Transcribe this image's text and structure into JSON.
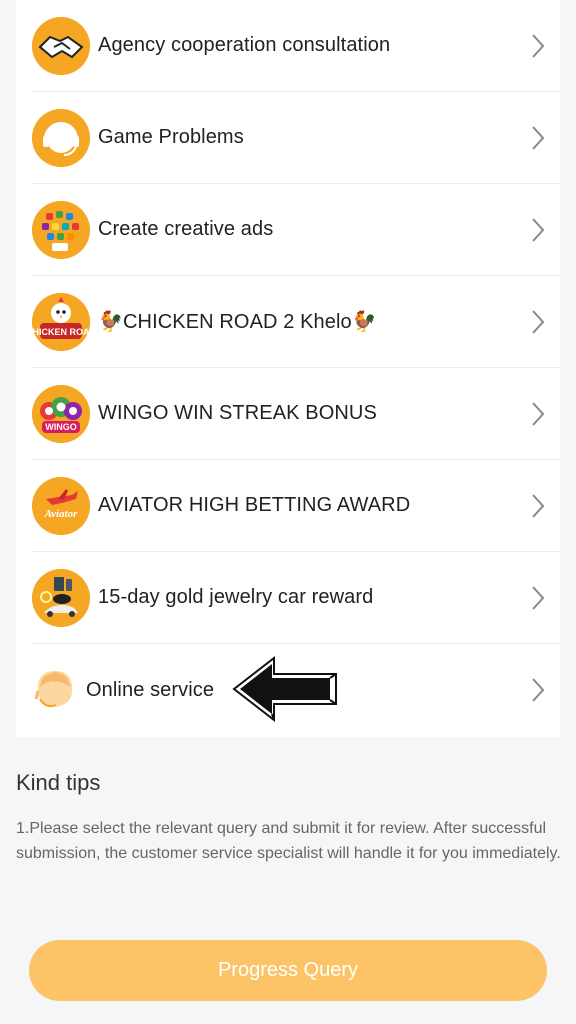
{
  "menu": {
    "items": [
      {
        "label": "Agency cooperation consultation",
        "icon": "handshake-icon"
      },
      {
        "label": "Game Problems",
        "icon": "headset-icon"
      },
      {
        "label": "Create creative ads",
        "icon": "apps-icon"
      },
      {
        "label": "🐓CHICKEN ROAD 2 Khelo🐓",
        "icon": "chicken-road-icon",
        "icon_text": "CHICKEN ROAD"
      },
      {
        "label": "WINGO WIN STREAK BONUS",
        "icon": "wingo-balls-icon",
        "icon_text": "WINGO"
      },
      {
        "label": "AVIATOR HIGH BETTING AWARD",
        "icon": "aviator-plane-icon",
        "icon_text": "Aviator"
      },
      {
        "label": "15-day gold jewelry car reward",
        "icon": "rewards-icon"
      },
      {
        "label": "Online service",
        "icon": "customer-service-agent-icon"
      }
    ]
  },
  "tips": {
    "title": "Kind tips",
    "text": "1.Please select the relevant query and submit it for review. After successful submission, the customer service specialist will handle it for you immediately."
  },
  "button": {
    "label": "Progress Query"
  },
  "colors": {
    "accent": "#f5a623",
    "button": "#fcc467",
    "background": "#f6f6f8"
  }
}
